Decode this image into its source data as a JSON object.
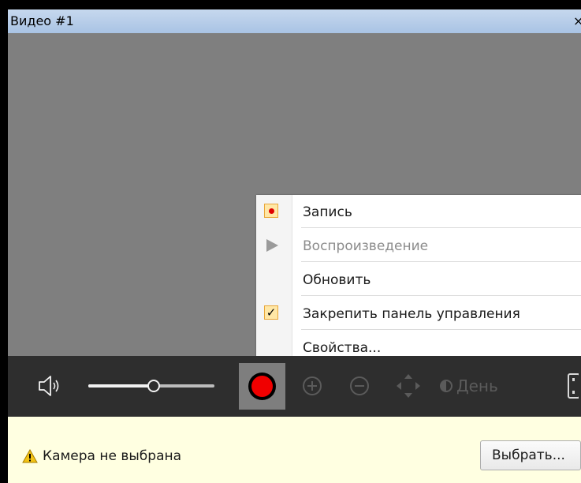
{
  "window": {
    "title": "Видео #1",
    "close_glyph": "×"
  },
  "context_menu": {
    "items": [
      {
        "label": "Запись",
        "icon": "record-icon",
        "enabled": true
      },
      {
        "label": "Воспроизведение",
        "icon": "play-icon",
        "enabled": false
      },
      {
        "label": "Обновить",
        "icon": "",
        "enabled": true
      },
      {
        "label": "Закрепить панель управления",
        "icon": "checkmark-icon",
        "checked": true,
        "enabled": true
      },
      {
        "label": "Свойства...",
        "icon": "",
        "enabled": true
      }
    ]
  },
  "toolbar": {
    "speaker_icon": "speaker-icon",
    "volume_level": 0.52,
    "record_button_icon": "record-icon",
    "zoom_in_icon": "zoom-in-icon",
    "zoom_out_icon": "zoom-out-icon",
    "ptz_icon": "move-arrows-icon",
    "day_mode_label": "День",
    "colors": {
      "background": "#2e2e2e",
      "disabled_icon": "#5b5b5b",
      "record_red": "#f00000"
    }
  },
  "status_bar": {
    "warning_icon": "warning-icon",
    "message": "Камера не выбрана",
    "select_button_label": "Выбрать...",
    "background": "#ffffe1"
  }
}
